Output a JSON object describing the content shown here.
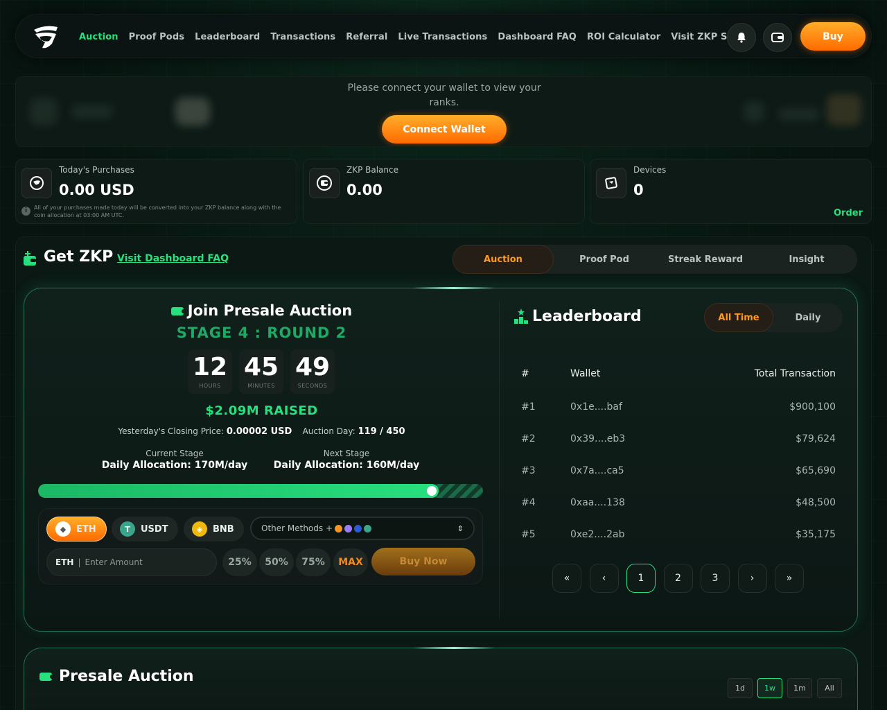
{
  "nav": {
    "links": [
      "Auction",
      "Proof Pods",
      "Leaderboard",
      "Transactions",
      "Referral",
      "Live Transactions",
      "Dashboard FAQ",
      "ROI Calculator",
      "Visit ZKP Site"
    ],
    "active": "Auction",
    "buy_label": "Buy"
  },
  "connect": {
    "message": "Please connect your wallet to view your ranks.",
    "button": "Connect Wallet"
  },
  "stats": [
    {
      "label": "Today's Purchases",
      "value": "0.00 USD",
      "note": "All of your purchases made today will be converted into your ZKP balance along with the coin allocation at 03:00 AM UTC."
    },
    {
      "label": "ZKP Balance",
      "value": "0.00"
    },
    {
      "label": "Devices",
      "value": "0",
      "link": "Order"
    }
  ],
  "get_zkp": {
    "title": "Get ZKP",
    "faq_link": "Visit Dashboard FAQ",
    "tabs": [
      "Auction",
      "Proof Pod",
      "Streak Reward",
      "Insight"
    ],
    "active_tab": "Auction"
  },
  "auction": {
    "title": "Join Presale Auction",
    "stage": "STAGE 4 : ROUND 2",
    "timer": [
      {
        "value": "12",
        "label": "HOURS"
      },
      {
        "value": "45",
        "label": "MINUTES"
      },
      {
        "value": "49",
        "label": "SECONDS"
      }
    ],
    "raised": "$2.09M RAISED",
    "closing_price_label": "Yesterday's Closing Price:",
    "closing_price": "0.00002 USD",
    "auction_day_label": "Auction Day:",
    "auction_day": "119 / 450",
    "current_stage_label": "Current Stage",
    "current_stage_value": "Daily Allocation: 170M/day",
    "next_stage_label": "Next Stage",
    "next_stage_value": "Daily Allocation: 160M/day",
    "progress": 0.9
  },
  "buy": {
    "coins": [
      "ETH",
      "USDT",
      "BNB"
    ],
    "active_coin": "ETH",
    "other_methods": "Other Methods +",
    "currency": "ETH",
    "amount_placeholder": "Enter Amount",
    "percents": [
      "25%",
      "50%",
      "75%",
      "MAX"
    ],
    "buy_now": "Buy Now"
  },
  "leaderboard": {
    "title": "Leaderboard",
    "toggles": [
      "All Time",
      "Daily"
    ],
    "active_toggle": "All Time",
    "headers": [
      "#",
      "Wallet",
      "Total Transaction"
    ],
    "rows": [
      {
        "rank": "#1",
        "wallet": "0x1e....baf",
        "total": "$900,100"
      },
      {
        "rank": "#2",
        "wallet": "0x39....eb3",
        "total": "$79,624"
      },
      {
        "rank": "#3",
        "wallet": "0x7a....ca5",
        "total": "$65,690"
      },
      {
        "rank": "#4",
        "wallet": "0xaa....138",
        "total": "$48,500"
      },
      {
        "rank": "#5",
        "wallet": "0xe2....2ab",
        "total": "$35,175"
      }
    ],
    "pages": [
      "«",
      "‹",
      "1",
      "2",
      "3",
      "›",
      "»"
    ],
    "active_page": "1"
  },
  "presale": {
    "title": "Presale Auction",
    "ranges": [
      "1d",
      "1w",
      "1m",
      "All"
    ],
    "active_range": "1w"
  },
  "colors": {
    "accent_green": "#27e07e",
    "accent_orange": "#ff9a1f"
  }
}
